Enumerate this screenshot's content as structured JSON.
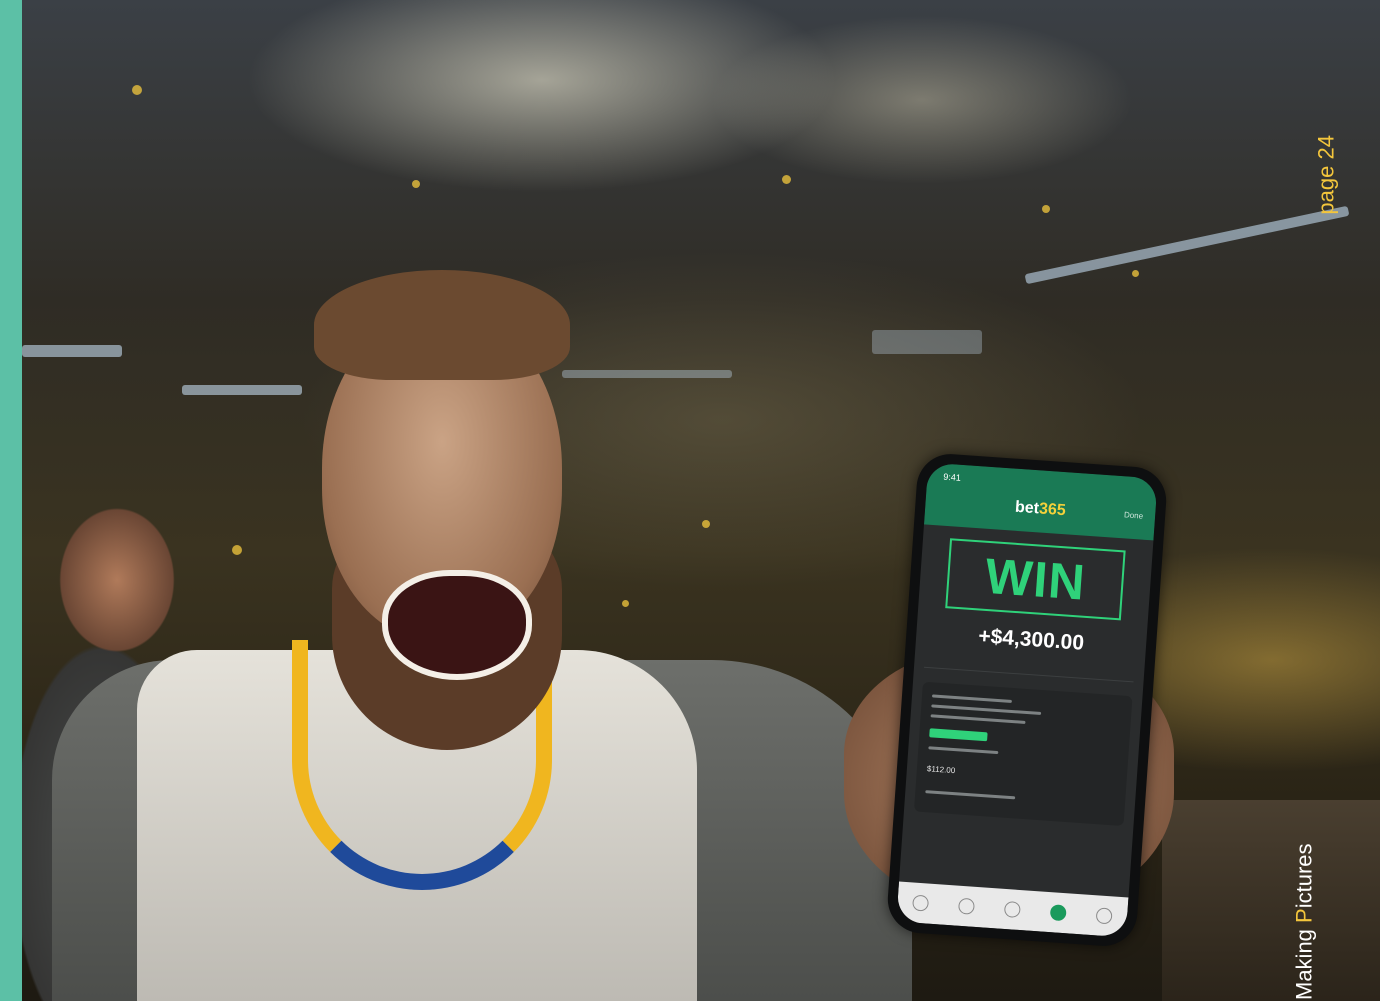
{
  "page_label": {
    "word": "page",
    "number": "24"
  },
  "footer_label": {
    "part1": "Making ",
    "part2_highlight": "P",
    "part3": "ictures"
  },
  "phone": {
    "status_time": "9:41",
    "brand_prefix": "bet",
    "brand_number": "365",
    "close_label": "Done",
    "result": "WIN",
    "payout": "+$4,300.00",
    "stake": "$112.00"
  },
  "colors": {
    "teal_strip": "#5cc0a6",
    "win_green": "#2fd27a",
    "brand_yellow": "#f4d13a",
    "header_green": "#1a7a55"
  }
}
